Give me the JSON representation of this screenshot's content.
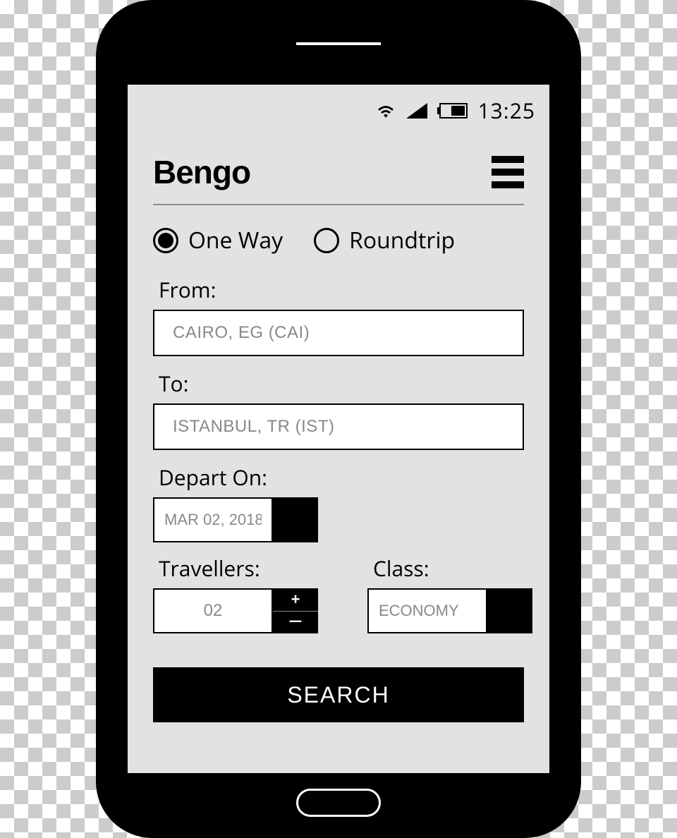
{
  "status": {
    "time": "13:25"
  },
  "app": {
    "title": "Bengo"
  },
  "trip_type": {
    "one_way": "One Way",
    "roundtrip": "Roundtrip"
  },
  "form": {
    "from_label": "From:",
    "from_value": "CAIRO, EG (CAI)",
    "to_label": "To:",
    "to_value": "ISTANBUL, TR (IST)",
    "depart_label": "Depart On:",
    "depart_value": "MAR 02, 2018",
    "travellers_label": "Travellers:",
    "travellers_value": "02",
    "class_label": "Class:",
    "class_value": "ECONOMY",
    "search_label": "SEARCH"
  }
}
